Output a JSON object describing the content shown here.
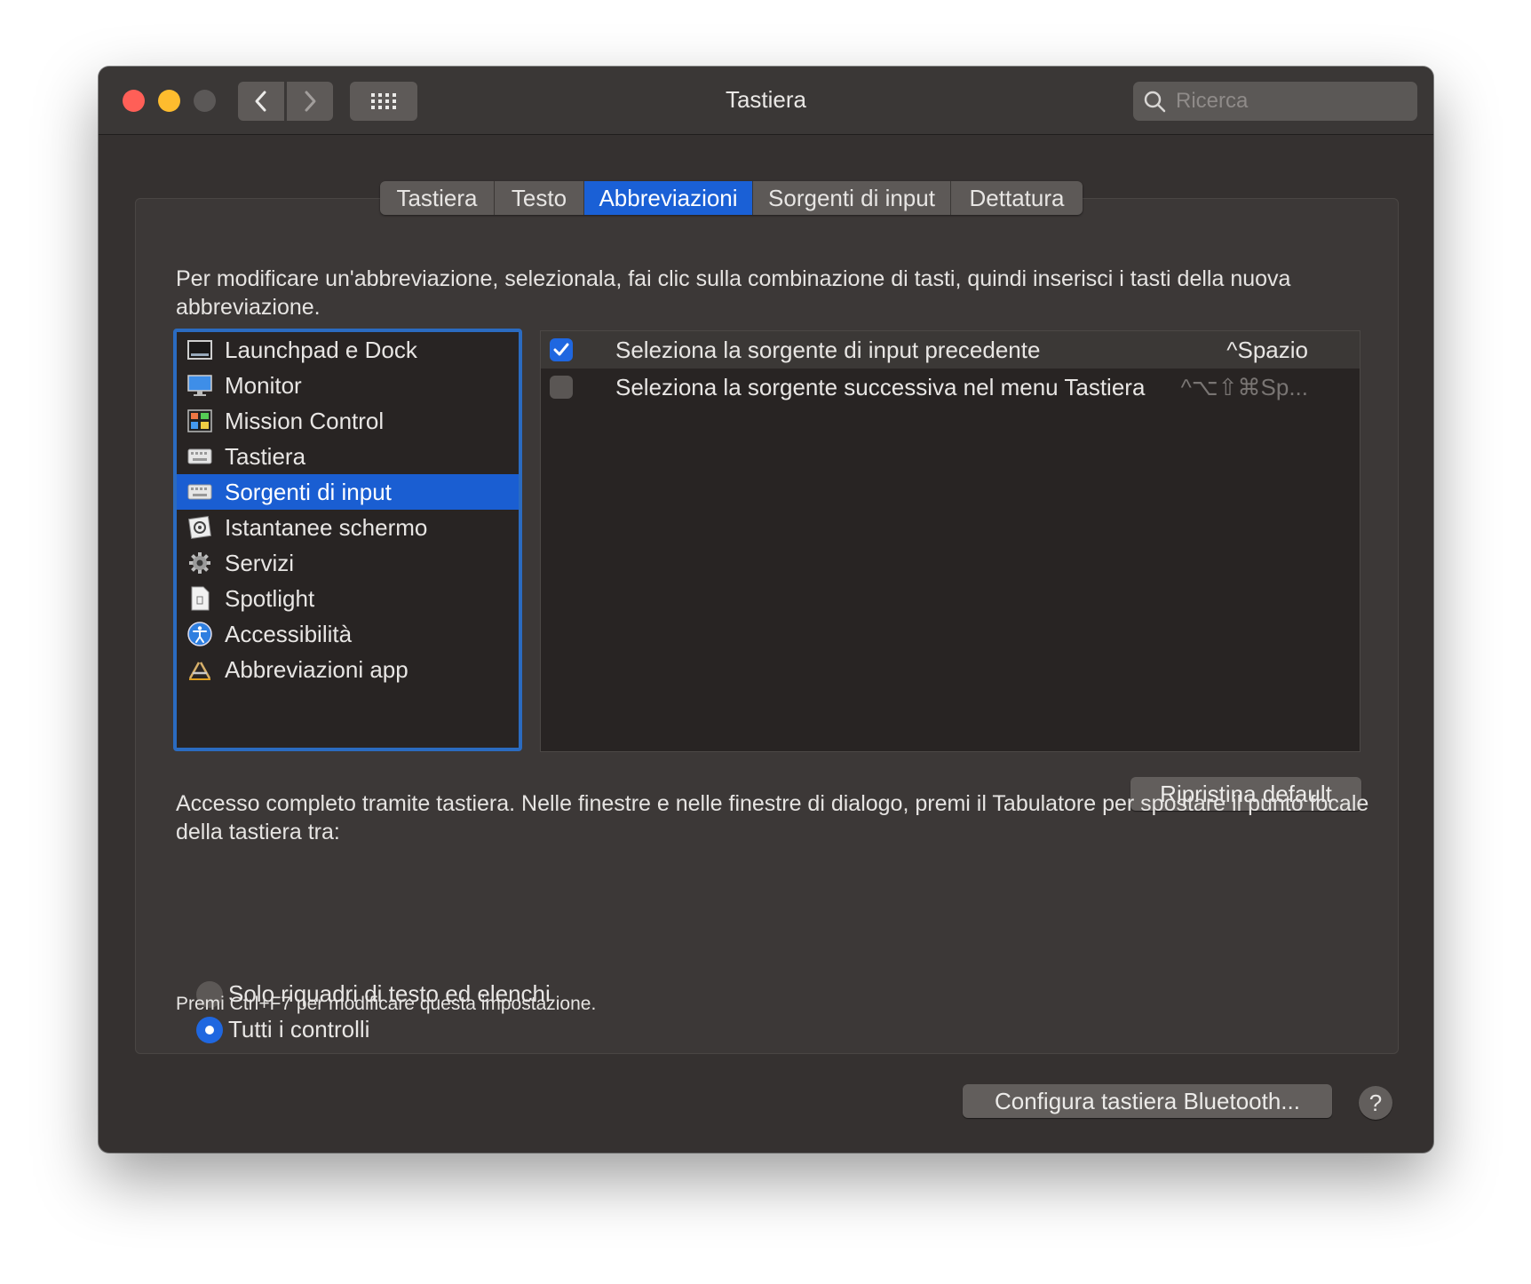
{
  "window": {
    "title": "Tastiera",
    "search_placeholder": "Ricerca"
  },
  "tabs": [
    {
      "label": "Tastiera",
      "active": false
    },
    {
      "label": "Testo",
      "active": false
    },
    {
      "label": "Abbreviazioni",
      "active": true
    },
    {
      "label": "Sorgenti di input",
      "active": false
    },
    {
      "label": "Dettatura",
      "active": false
    }
  ],
  "instructions": "Per modificare un'abbreviazione, selezionala, fai clic sulla combinazione di tasti, quindi inserisci i tasti della nuova abbreviazione.",
  "categories": [
    {
      "label": "Launchpad e Dock",
      "icon": "launchpad-icon"
    },
    {
      "label": "Monitor",
      "icon": "monitor-icon"
    },
    {
      "label": "Mission Control",
      "icon": "mission-control-icon"
    },
    {
      "label": "Tastiera",
      "icon": "keyboard-icon"
    },
    {
      "label": "Sorgenti di input",
      "icon": "keyboard-icon",
      "selected": true
    },
    {
      "label": "Istantanee schermo",
      "icon": "screenshot-icon"
    },
    {
      "label": "Servizi",
      "icon": "gear-icon"
    },
    {
      "label": "Spotlight",
      "icon": "document-icon"
    },
    {
      "label": "Accessibilità",
      "icon": "accessibility-icon"
    },
    {
      "label": "Abbreviazioni app",
      "icon": "app-shortcuts-icon"
    }
  ],
  "shortcuts": [
    {
      "label": "Seleziona la sorgente di input precedente",
      "key": "^Spazio",
      "checked": true
    },
    {
      "label": "Seleziona la sorgente successiva nel menu Tastiera",
      "key": "^⌥⇧⌘Sp...",
      "checked": false
    }
  ],
  "reset_button": "Ripristina default",
  "full_access_text": "Accesso completo tramite tastiera. Nelle finestre e nelle finestre di dialogo, premi il Tabulatore per spostare il punto focale della tastiera tra:",
  "radio_options": [
    {
      "label": "Solo riquadri di testo ed elenchi",
      "selected": false
    },
    {
      "label": "Tutti i controlli",
      "selected": true
    }
  ],
  "hint": "Premi Ctrl+F7 per modificare questa impostazione.",
  "bluetooth_button": "Configura tastiera Bluetooth...",
  "help_label": "?",
  "colors": {
    "accent": "#1a60d6",
    "window_bg": "#353130",
    "close": "#ff5f57",
    "minimize": "#febc2e"
  }
}
